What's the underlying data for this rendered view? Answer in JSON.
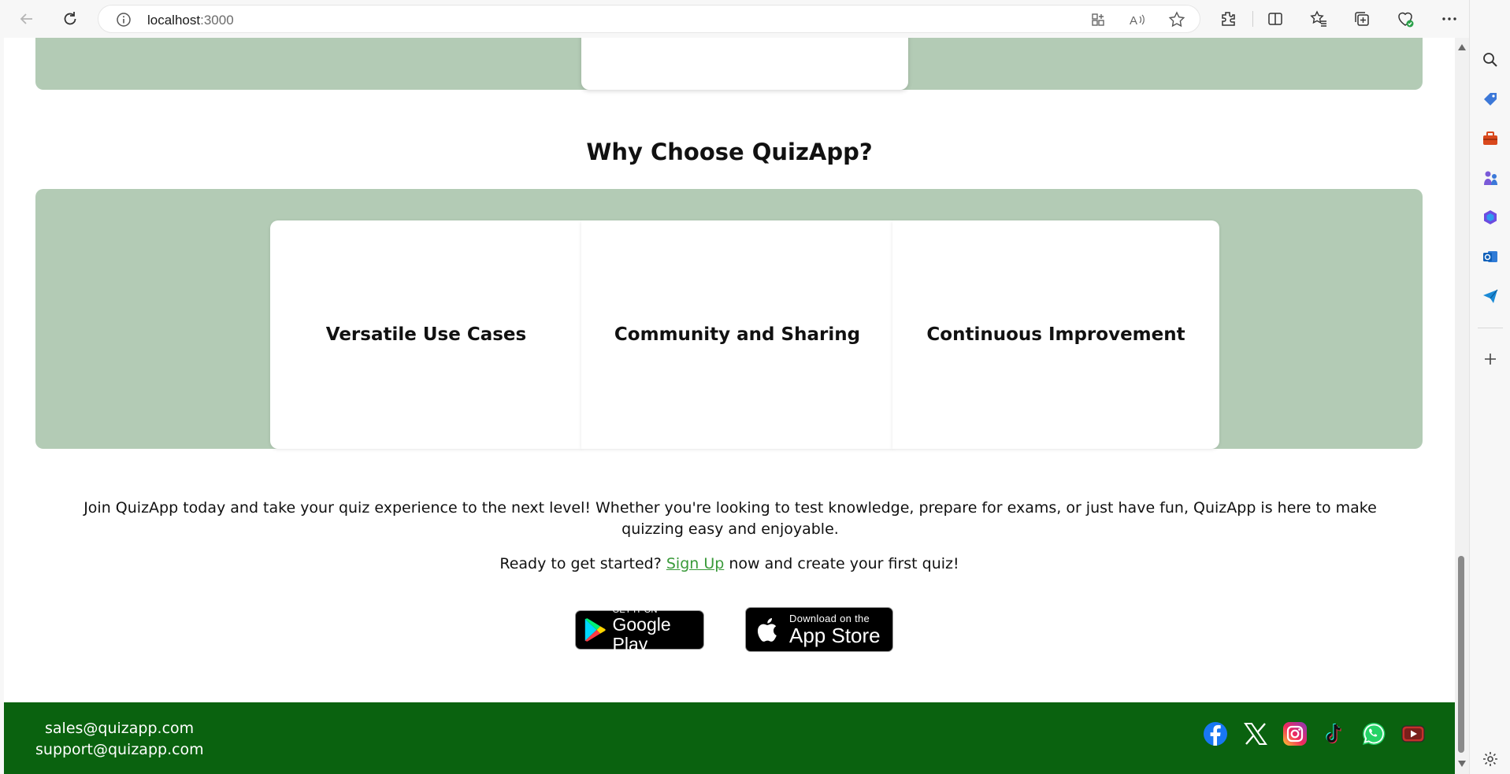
{
  "browser": {
    "url_host": "localhost",
    "url_port": ":3000"
  },
  "page": {
    "section_title": "Why Choose QuizApp?",
    "features": [
      {
        "title": "Versatile Use Cases"
      },
      {
        "title": "Community and Sharing"
      },
      {
        "title": "Continuous Improvement"
      }
    ],
    "join_text": "Join QuizApp today and take your quiz experience to the next level! Whether you're looking to test knowledge, prepare for exams, or just have fun, QuizApp is here to make quizzing easy and enjoyable.",
    "ready_before": "Ready to get started?",
    "ready_link": "Sign Up",
    "ready_after": "now and create your first quiz!",
    "google_play": {
      "small": "GET IT ON",
      "big": "Google Play"
    },
    "app_store": {
      "small": "Download on the",
      "big": "App Store"
    }
  },
  "footer": {
    "emails": [
      "sales@quizapp.com",
      "support@quizapp.com"
    ],
    "social_icons": [
      "facebook-icon",
      "x-icon",
      "instagram-icon",
      "tiktok-icon",
      "whatsapp-icon",
      "youtube-icon"
    ]
  },
  "colors": {
    "band_green": "#b3cbb5",
    "footer_green": "#0a620f",
    "link_green": "#3a9a3a"
  }
}
